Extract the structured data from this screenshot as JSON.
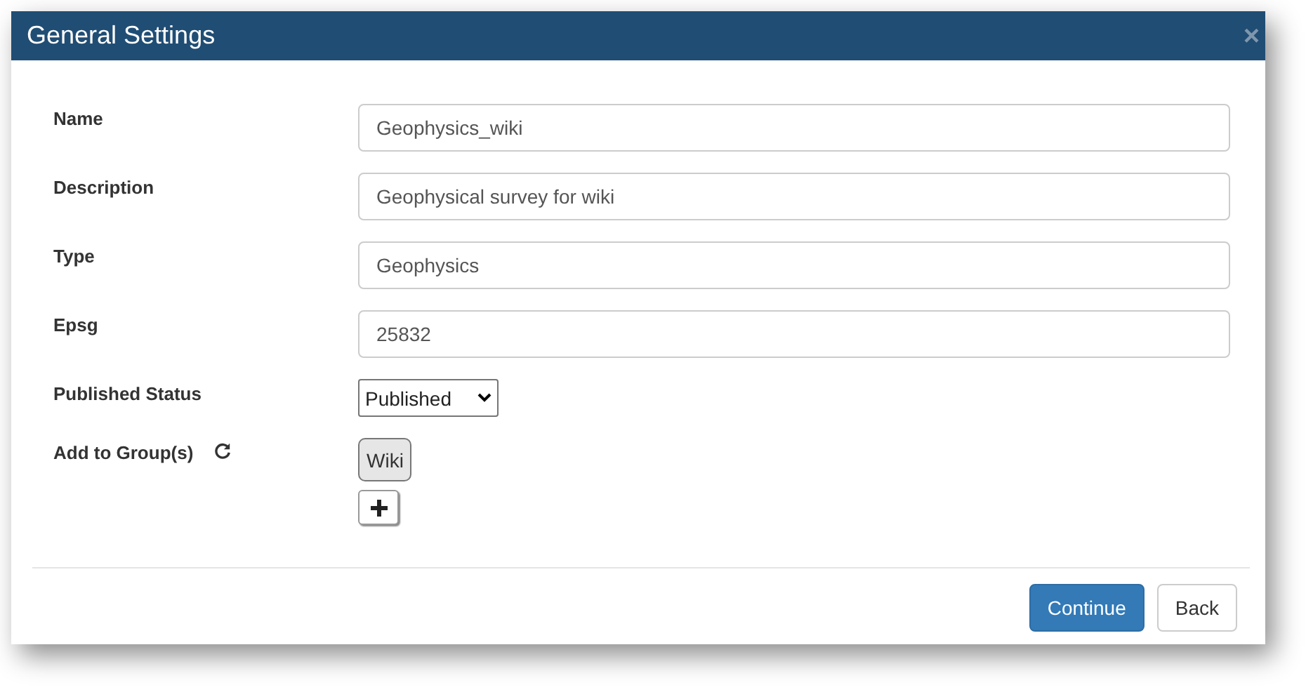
{
  "window": {
    "title": "General Settings",
    "close": "×"
  },
  "fields": [
    {
      "label": "Name",
      "kind": "text",
      "value": "Geophysics_wiki"
    },
    {
      "label": "Description",
      "kind": "text",
      "value": "Geophysical survey for wiki"
    },
    {
      "label": "Type",
      "kind": "text",
      "value": "Geophysics"
    },
    {
      "label": "Epsg",
      "kind": "text",
      "value": "25832"
    },
    {
      "label": "Published Status",
      "kind": "select",
      "value": "Published"
    }
  ],
  "groups": {
    "label": "Add to Group(s)",
    "items": [
      "Wiki"
    ]
  },
  "buttons": [
    {
      "label": "Continue",
      "kind": "primary"
    },
    {
      "label": "Back",
      "kind": "default"
    }
  ]
}
